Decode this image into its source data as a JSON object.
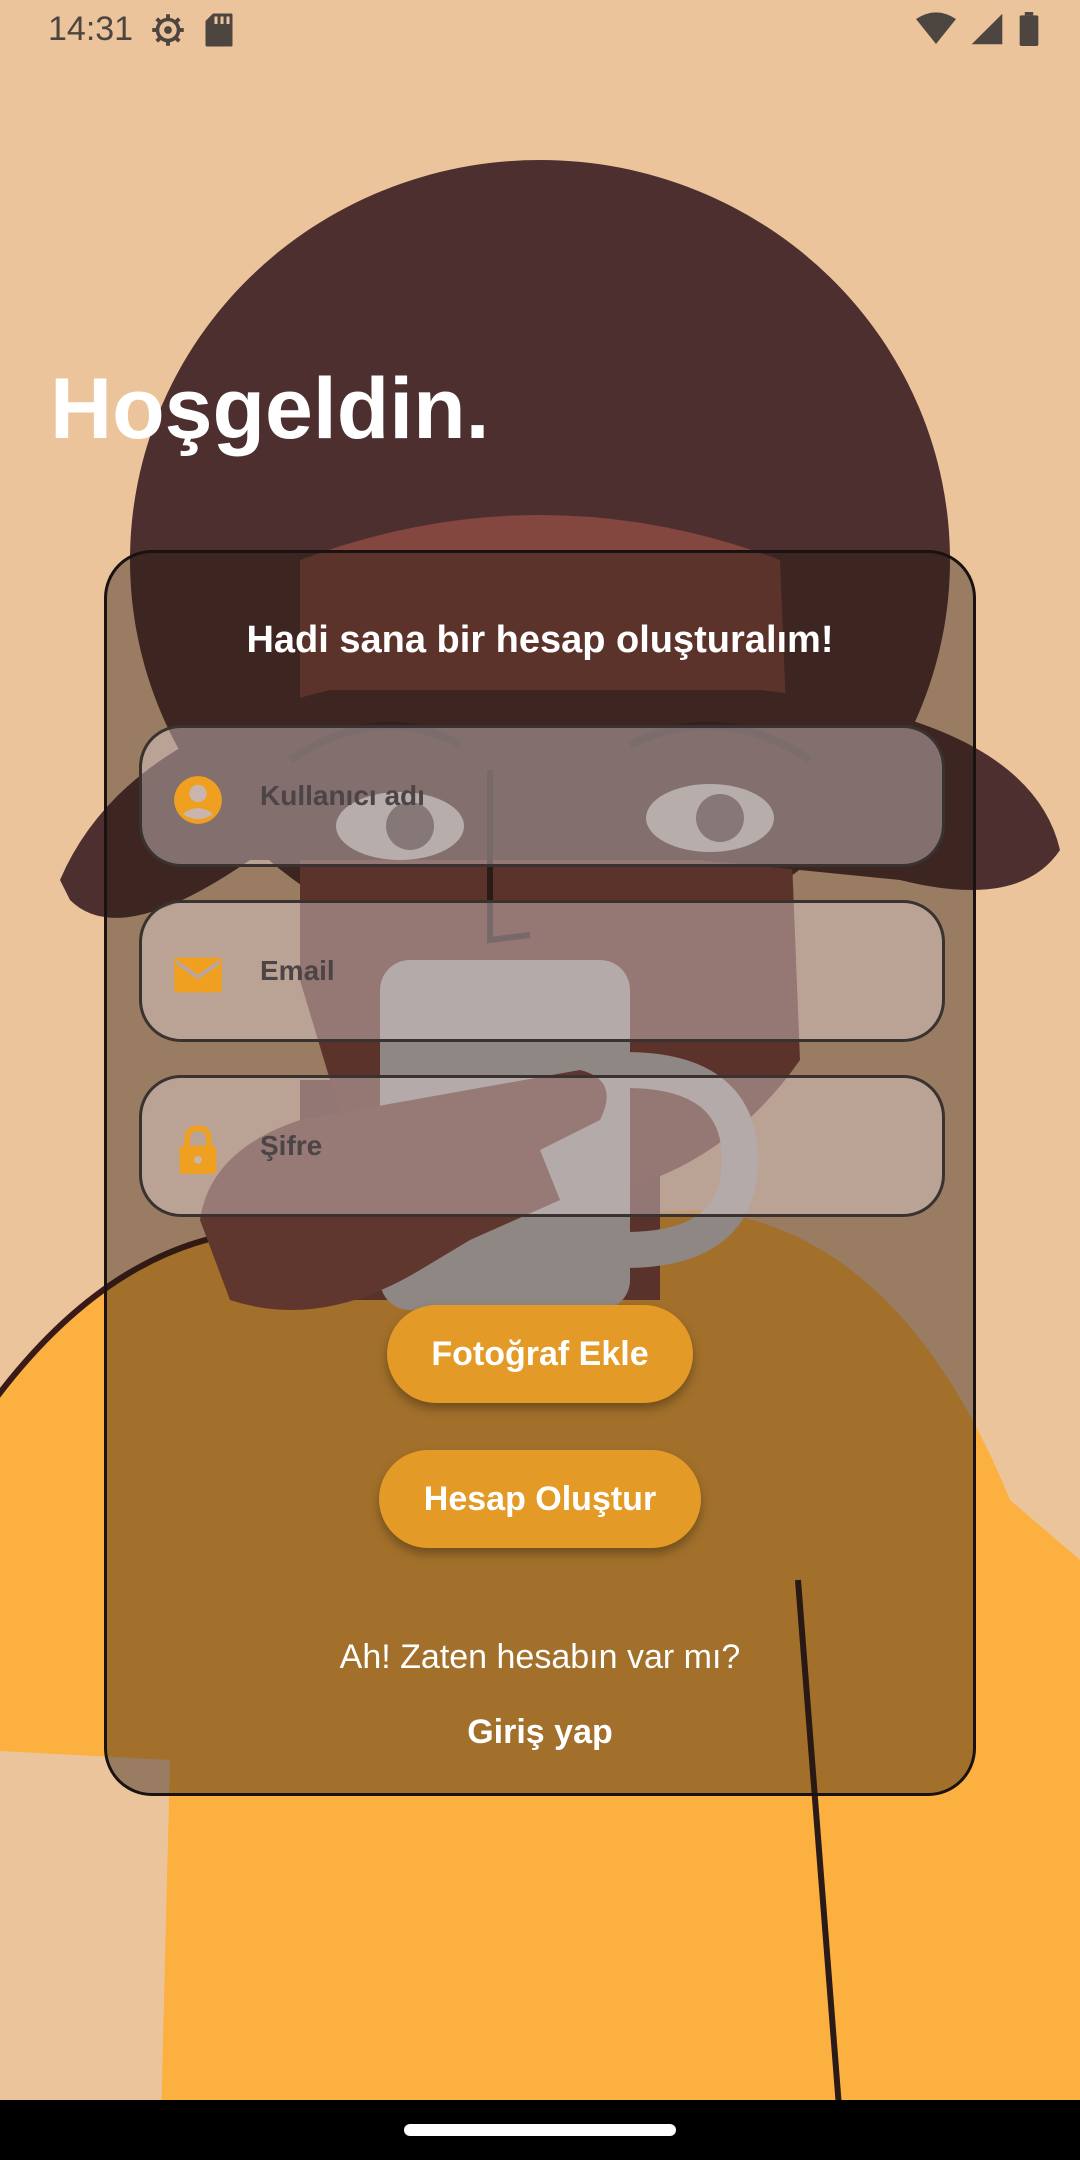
{
  "status_bar": {
    "time": "14:31",
    "left_icons": [
      "settings-icon",
      "sd-card-icon"
    ],
    "right_icons": [
      "wifi-icon",
      "cell-signal-icon",
      "battery-icon"
    ]
  },
  "welcome_title": "Hoşgeldin.",
  "card": {
    "heading": "Hadi sana bir hesap oluşturalım!",
    "fields": {
      "username": {
        "placeholder": "Kullanıcı adı",
        "icon": "account-circle-icon"
      },
      "email": {
        "placeholder": "Email",
        "icon": "mail-icon"
      },
      "password": {
        "placeholder": "Şifre",
        "icon": "lock-icon"
      }
    },
    "buttons": {
      "add_photo": "Fotoğraf Ekle",
      "create_account": "Hesap Oluştur"
    },
    "have_account_text": "Ah! Zaten hesabın var mı?",
    "login_link": "Giriş yap"
  },
  "colors": {
    "background": "#ecc49c",
    "accent": "#e49a26",
    "icon": "#f0a020",
    "hair": "#4e2f30",
    "sweater": "#fcb03f"
  }
}
